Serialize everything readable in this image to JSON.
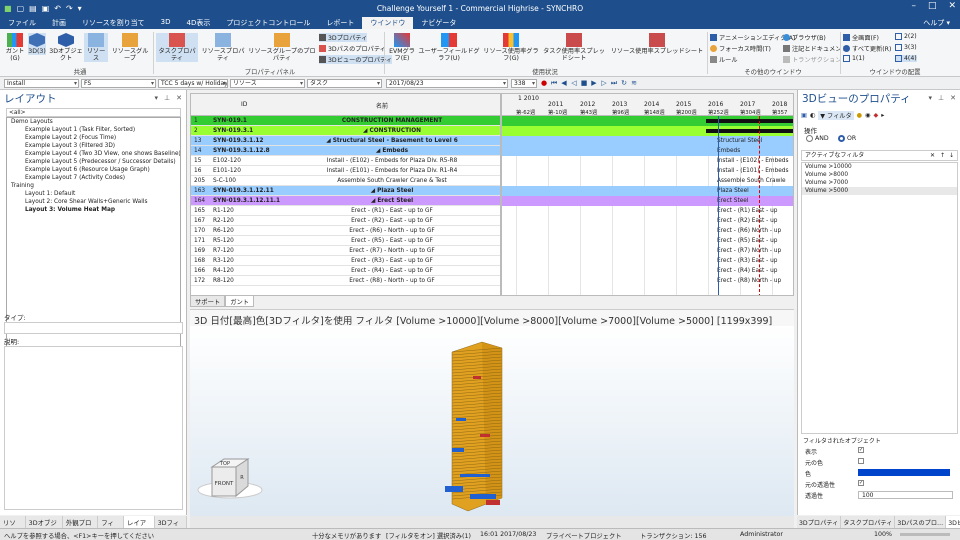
{
  "window": {
    "title": "Challenge Yourself 1 - Commercial Highrise - SYNCHRO"
  },
  "menu": {
    "items": [
      "ファイル",
      "計画",
      "リソースを割り当て",
      "3D",
      "4D表示",
      "プロジェクトコントロール",
      "レポート",
      "ウインドウ",
      "ナビゲータ"
    ],
    "help": "ヘルプ ▾"
  },
  "ribbon": {
    "btn_gantt": "ガント(G)",
    "btn_3d": "3D(3)",
    "btn_3dobj": "3Dオブジェクト",
    "btn_resource": "リソース",
    "btn_resgroup": "リソースグループ",
    "group_common": "共通",
    "btn_taskprop": "タスクプロパティ",
    "btn_resprop": "リソースプロパティ",
    "btn_resgroupprop": "リソースグループのプロパティ",
    "btn_3dprop": "3Dプロパティ",
    "btn_3dpathprop": "3Dパスのプロパティ",
    "btn_3dviewprop": "3Dビューのプロパティ",
    "group_propertypanel": "プロパティパネル",
    "btn_evm": "EVMグラフ(E)",
    "btn_userfield": "ユーザーフィールドグラフ(U)",
    "btn_resusage": "リソース使用率グラフ(G)",
    "btn_taskusage": "タスク使用率スプレッドシート",
    "btn_resusagesheet": "リソース使用率スプレッドシート",
    "group_usage": "使用状況",
    "btn_anim": "アニメーションエディタ(A)",
    "btn_focus": "フォーカス時間(T)",
    "btn_rule": "ルール",
    "btn_browser": "ブラウザ(B)",
    "btn_notes": "注記とドキュメント",
    "btn_trans": "トランザクション",
    "group_otherwin": "その他のウインドウ",
    "btn_fullscreen": "全画面(F)",
    "btn_updateall": "すべて更新(R)",
    "btn_1to1": "1(1)",
    "btn_22": "2(2)",
    "btn_33": "3(3)",
    "btn_44": "4(4)",
    "group_winlayout": "ウインドウの配置"
  },
  "toolbar": {
    "combo1": "Install",
    "combo2": "FS",
    "combo3": "TCC 5 days w/ Holidays (",
    "combo4": "リソース",
    "combo5": "タスク",
    "date": "2017/08/23",
    "zoom": "338"
  },
  "left": {
    "title": "レイアウト",
    "search": "<all>",
    "items": [
      {
        "t": "Demo Layouts",
        "c": "cat"
      },
      {
        "t": "Example Layout 1 (Task Filter, Sorted)",
        "c": "l1"
      },
      {
        "t": "Example Layout 2 (Focus Time)",
        "c": "l1"
      },
      {
        "t": "Example Layout 3 (Filtered 3D)",
        "c": "l1"
      },
      {
        "t": "Example Layout 4 (Two 3D View, one shows Baseline)",
        "c": "l1"
      },
      {
        "t": "Example Layout 5 (Predecessor / Successor Details)",
        "c": "l1"
      },
      {
        "t": "Example Layout 6 (Resource Usage Graph)",
        "c": "l1"
      },
      {
        "t": "Example Layout 7 (Activity Codes)",
        "c": "l1"
      },
      {
        "t": "Training",
        "c": "cat"
      },
      {
        "t": "Layout 1: Default",
        "c": "l1"
      },
      {
        "t": "Layout 2: Core Shear Walls+Generic Walls",
        "c": "l1"
      },
      {
        "t": "Layout 3: Volume Heat Map",
        "c": "l1 sel"
      }
    ],
    "type_label": "タイプ:",
    "desc_label": "説明:",
    "tabs": [
      "リソース",
      "3Dオブジェ…",
      "外観プロフ…",
      "フィルタ",
      "レイアウト",
      "3Dフィルタ"
    ]
  },
  "gantt": {
    "col_id": "ID",
    "col_name": "名前",
    "tl_month": "1 2010",
    "years": [
      "2011",
      "2012",
      "2013",
      "2014",
      "2015",
      "2016",
      "2017",
      "2018"
    ],
    "weeks": [
      "第-62週",
      "第-10週",
      "第43週",
      "第96週",
      "第148週",
      "第200週",
      "第252週",
      "第304週",
      "第357"
    ],
    "rows": [
      {
        "n": "1",
        "id": "SYN-019.1",
        "name": "CONSTRUCTION MANAGEMENT",
        "bg": "#33cc33",
        "bar": ""
      },
      {
        "n": "2",
        "id": "SYN-019.3.1",
        "name": "◢ CONSTRUCTION",
        "bg": "#99ff33",
        "bar": ""
      },
      {
        "n": "13",
        "id": "SYN-019.3.1.12",
        "name": "◢ Structural Steel - Basement to Level 6",
        "bg": "#99ccff",
        "bar": "Structural Steel"
      },
      {
        "n": "14",
        "id": "SYN-019.3.1.12.8",
        "name": "◢ Embeds",
        "bg": "#99ccff",
        "bar": "Embeds"
      },
      {
        "n": "15",
        "id": "E102-120",
        "name": "Install - (E102) - Embeds for Plaza Div. R5-R8",
        "bg": "#ffffff",
        "bar": "Install - (E102) - Embeds"
      },
      {
        "n": "16",
        "id": "E101-120",
        "name": "Install - (E101) - Embeds for Plaza Div. R1-R4",
        "bg": "#ffffff",
        "bar": "Install - (E101) - Embeds"
      },
      {
        "n": "205",
        "id": "S-C-100",
        "name": "Assemble South Crawler Crane & Test",
        "bg": "#ffffff",
        "bar": "Assemble South Crawle"
      },
      {
        "n": "163",
        "id": "SYN-019.3.1.12.11",
        "name": "◢ Plaza Steel",
        "bg": "#99ccff",
        "bar": "Plaza Steel"
      },
      {
        "n": "164",
        "id": "SYN-019.3.1.12.11.1",
        "name": "◢ Erect Steel",
        "bg": "#cc99ff",
        "bar": "Erect Steel"
      },
      {
        "n": "165",
        "id": "R1-120",
        "name": "Erect - (R1) - East - up to GF",
        "bg": "#ffffff",
        "bar": "Erect - (R1)  East - up"
      },
      {
        "n": "167",
        "id": "R2-120",
        "name": "Erect - (R2) - East - up to GF",
        "bg": "#ffffff",
        "bar": "Erect - (R2)  East - up"
      },
      {
        "n": "170",
        "id": "R6-120",
        "name": "Erect - (R6) - North - up to GF",
        "bg": "#ffffff",
        "bar": "Erect - (R6)  North - up"
      },
      {
        "n": "171",
        "id": "R5-120",
        "name": "Erect - (R5) - East - up to GF",
        "bg": "#ffffff",
        "bar": "Erect - (R5)  East - up"
      },
      {
        "n": "169",
        "id": "R7-120",
        "name": "Erect - (R7) - North - up to GF",
        "bg": "#ffffff",
        "bar": "Erect - (R7)  North - up"
      },
      {
        "n": "168",
        "id": "R3-120",
        "name": "Erect - (R3) - East - up to GF",
        "bg": "#ffffff",
        "bar": "Erect - (R3)  East - up"
      },
      {
        "n": "166",
        "id": "R4-120",
        "name": "Erect - (R4) - East - up to GF",
        "bg": "#ffffff",
        "bar": "Erect - (R4)  East - up"
      },
      {
        "n": "172",
        "id": "R8-120",
        "name": "Erect - (R8) - North - up to GF",
        "bg": "#ffffff",
        "bar": "Erect - (R8)  North - up"
      }
    ],
    "tabs": [
      "サポート",
      "ガント"
    ]
  },
  "view3d": {
    "title": "3D 日付[最高]色[3Dフィルタ]を使用 フィルタ [Volume >10000][Volume >8000][Volume >7000][Volume >5000]  [1199x399]",
    "cube_top": "TOP",
    "cube_front": "FRONT",
    "cube_right": "R"
  },
  "right": {
    "title": "3Dビューのプロパティ",
    "tab_filter": "フィルタ",
    "op_label": "操作",
    "op_and": "AND",
    "op_or": "OR",
    "active_label": "アクティブなフィルタ",
    "filters": [
      "Volume >10000",
      "Volume >8000",
      "Volume >7000",
      "Volume >5000"
    ],
    "obj_label": "フィルタされたオブジェクト",
    "props": [
      {
        "k": "表示",
        "v": "✓"
      },
      {
        "k": "元の色",
        "v": ""
      },
      {
        "k": "色",
        "v": ""
      },
      {
        "k": "元の透過性",
        "v": "✓"
      },
      {
        "k": "透過性",
        "v": "100"
      }
    ],
    "tabs": [
      "3Dプロパティ",
      "タスクプロパティ",
      "3Dパスのプロ…",
      "3Dビューのプロ…"
    ]
  },
  "status": {
    "left": "ヘルプを参照する場合、<F1>キーを押してください",
    "mem": "十分なメモリがあります",
    "filter": "[フィルタをオン]  選択済み(1)",
    "date": "16:01 2017/08/23",
    "project": "プライベートプロジェクト",
    "trans": "トランザクション: 156",
    "user": "Administrator",
    "zoom": "100%"
  },
  "colors": {
    "accent": "#1e4f8c",
    "blue_filter": "#0044cc"
  }
}
